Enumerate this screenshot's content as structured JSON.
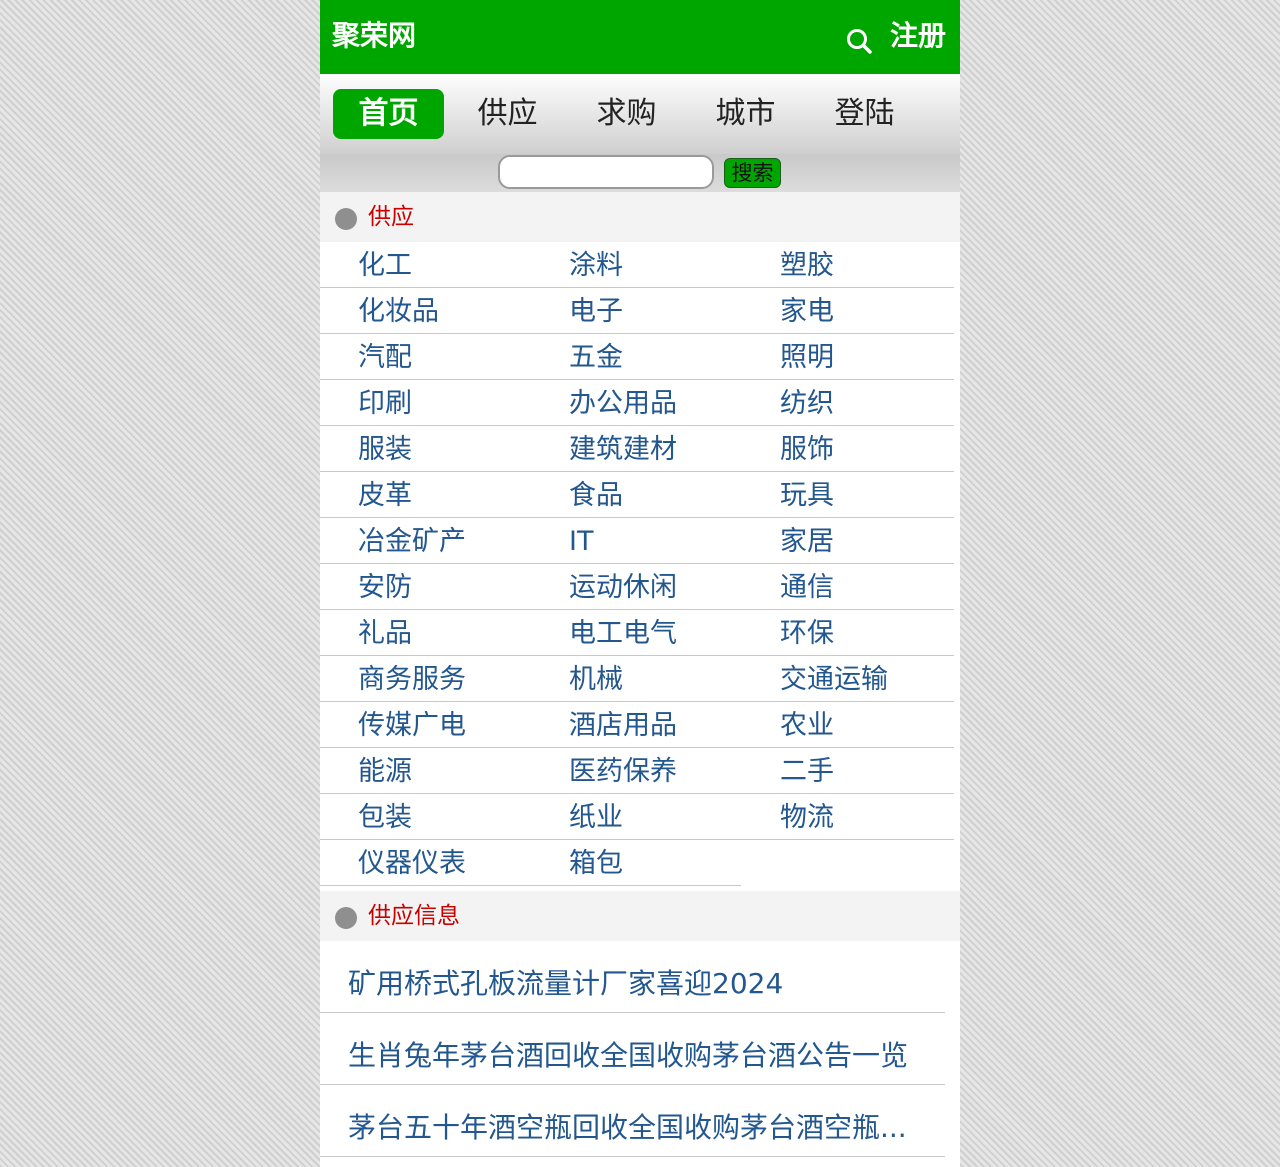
{
  "header": {
    "logo": "聚荣网",
    "search_icon": "search-icon",
    "register_label": "注册",
    "brand_color": "#00a600"
  },
  "nav": {
    "items": [
      "首页",
      "供应",
      "求购",
      "城市",
      "登陆"
    ],
    "active_index": 0
  },
  "search": {
    "input_value": "",
    "submit_label": "搜索"
  },
  "supply_section": {
    "title": "供应",
    "categories": [
      [
        "化工",
        "涂料",
        "塑胶"
      ],
      [
        "化妆品",
        "电子",
        "家电"
      ],
      [
        "汽配",
        "五金",
        "照明"
      ],
      [
        "印刷",
        "办公用品",
        "纺织"
      ],
      [
        "服装",
        "建筑建材",
        "服饰"
      ],
      [
        "皮革",
        "食品",
        "玩具"
      ],
      [
        "冶金矿产",
        "IT",
        "家居"
      ],
      [
        "安防",
        "运动休闲",
        "通信"
      ],
      [
        "礼品",
        "电工电气",
        "环保"
      ],
      [
        "商务服务",
        "机械",
        "交通运输"
      ],
      [
        "传媒广电",
        "酒店用品",
        "农业"
      ],
      [
        "能源",
        "医药保养",
        "二手"
      ],
      [
        "包装",
        "纸业",
        "物流"
      ],
      [
        "仪器仪表",
        "箱包"
      ]
    ]
  },
  "info_section": {
    "title": "供应信息",
    "items": [
      "矿用桥式孔板流量计厂家喜迎2024",
      "生肖兔年茅台酒回收全国收购茅台酒公告一览",
      "茅台五十年酒空瓶回收全国收购茅台酒空瓶..."
    ]
  }
}
